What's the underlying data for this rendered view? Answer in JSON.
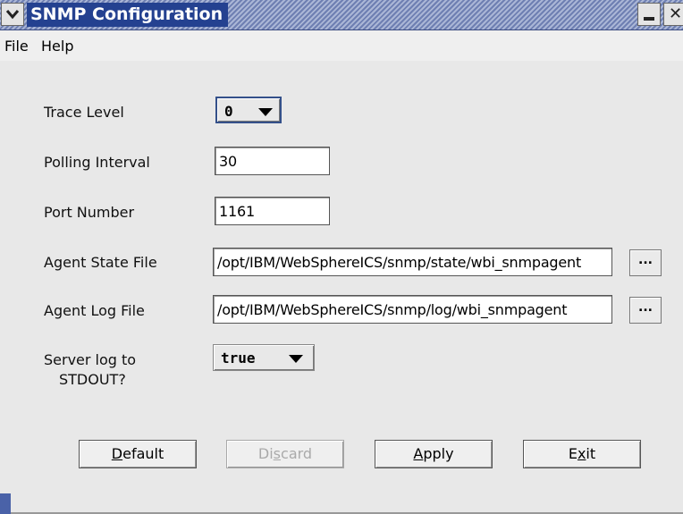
{
  "window": {
    "title": "SNMP Configuration"
  },
  "menu": {
    "file": "File",
    "help": "Help"
  },
  "form": {
    "trace_level": {
      "label": "Trace Level",
      "value": "0"
    },
    "polling_interval": {
      "label": "Polling Interval",
      "value": "30"
    },
    "port_number": {
      "label": "Port Number",
      "value": "1161"
    },
    "agent_state_file": {
      "label": "Agent State File",
      "value": "/opt/IBM/WebSphereICS/snmp/state/wbi_snmpagent",
      "browse": "..."
    },
    "agent_log_file": {
      "label": "Agent Log File",
      "value": "/opt/IBM/WebSphereICS/snmp/log/wbi_snmpagent",
      "browse": "..."
    },
    "server_log": {
      "label_line1": "Server log to",
      "label_line2": "STDOUT?",
      "value": "true"
    }
  },
  "buttons": {
    "default": {
      "pre": "",
      "mn": "D",
      "post": "efault"
    },
    "discard": {
      "pre": "Di",
      "mn": "s",
      "post": "card"
    },
    "apply": {
      "pre": "",
      "mn": "A",
      "post": "pply"
    },
    "exit": {
      "pre": "E",
      "mn": "x",
      "post": "it"
    }
  },
  "icons": {
    "system_menu": "chevron-down-icon",
    "minimize": "minimize-icon",
    "close": "close-icon"
  }
}
